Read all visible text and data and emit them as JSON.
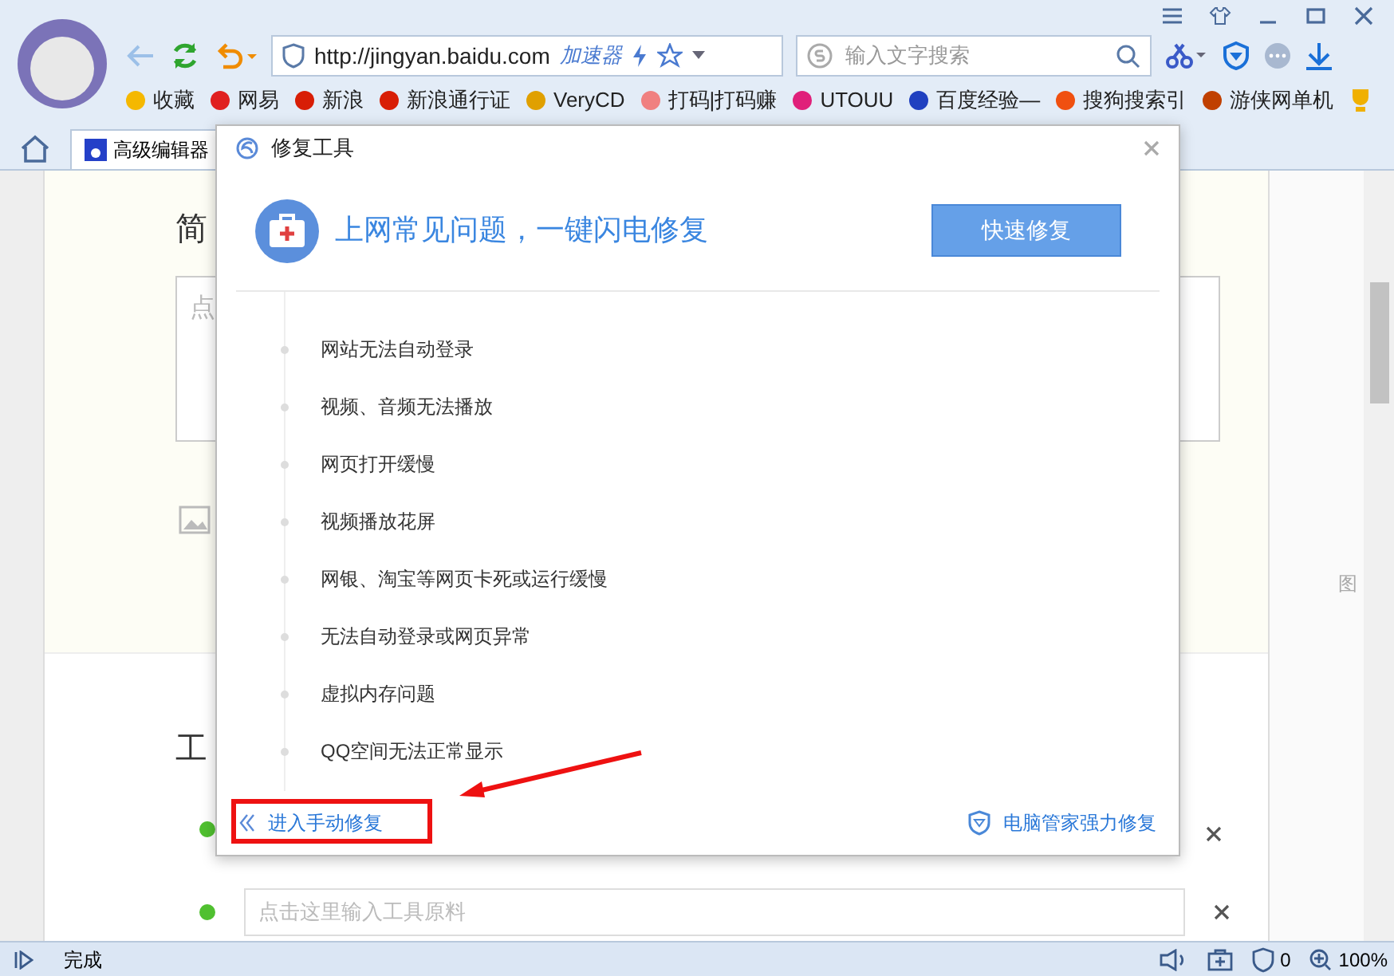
{
  "browser": {
    "address": "http://jingyan.baidu.com",
    "accelerator": "加速器",
    "search_placeholder": "输入文字搜索",
    "bookmarks": [
      {
        "label": "收藏"
      },
      {
        "label": "网易"
      },
      {
        "label": "新浪"
      },
      {
        "label": "新浪通行证"
      },
      {
        "label": "VeryCD"
      },
      {
        "label": "打码|打码赚"
      },
      {
        "label": "UTOUU"
      },
      {
        "label": "百度经验—"
      },
      {
        "label": "搜狗搜索引"
      },
      {
        "label": "游侠网单机"
      }
    ],
    "tab": {
      "title": "高级编辑器",
      "selected": true
    }
  },
  "page": {
    "heading_1": "简",
    "placeholder_1": "点",
    "heading_2": "工",
    "material_placeholder": "点击这里输入工具原料",
    "side_label": "图"
  },
  "dialog": {
    "title": "修复工具",
    "headline": "上网常见问题，一键闪电修复",
    "quick_fix": "快速修复",
    "issues": [
      "网站无法自动登录",
      "视频、音频无法播放",
      "网页打开缓慢",
      "视频播放花屏",
      "网银、淘宝等网页卡死或运行缓慢",
      "无法自动登录或网页异常",
      "虚拟内存问题",
      "QQ空间无法正常显示"
    ],
    "manual_link": "进入手动修复",
    "guard_link": "电脑管家强力修复"
  },
  "status_bar": {
    "status": "完成",
    "ad_count": "0",
    "zoom": "100%"
  }
}
